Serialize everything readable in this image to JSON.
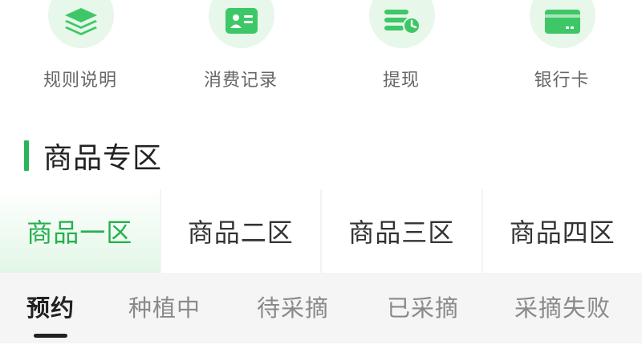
{
  "colors": {
    "accent": "#2bb35a",
    "icon_bg": "#e7f7ea",
    "icon_fg": "#3ec766",
    "text_muted": "#666666"
  },
  "quick_actions": [
    {
      "label": "规则说明",
      "icon": "layers-icon"
    },
    {
      "label": "消费记录",
      "icon": "id-card-icon"
    },
    {
      "label": "提现",
      "icon": "cash-clock-icon"
    },
    {
      "label": "银行卡",
      "icon": "bank-card-icon"
    }
  ],
  "section": {
    "title": "商品专区"
  },
  "zone_tabs": {
    "active_index": 0,
    "items": [
      "商品一区",
      "商品二区",
      "商品三区",
      "商品四区"
    ]
  },
  "status_tabs": {
    "active_index": 0,
    "items": [
      "预约",
      "种植中",
      "待采摘",
      "已采摘",
      "采摘失败"
    ]
  }
}
